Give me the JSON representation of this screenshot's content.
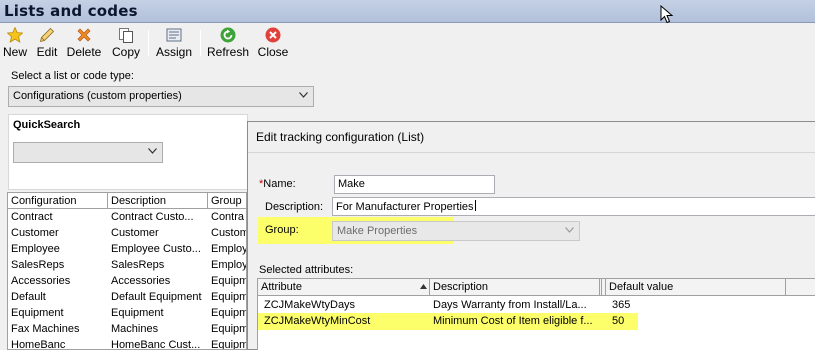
{
  "window": {
    "title": "Lists and codes"
  },
  "toolbar": {
    "new": "New",
    "edit": "Edit",
    "delete": "Delete",
    "copy": "Copy",
    "assign": "Assign",
    "refresh": "Refresh",
    "close": "Close"
  },
  "list_type": {
    "caption": "Select a list or code type:",
    "selected": "Configurations (custom properties)"
  },
  "quicksearch": {
    "title": "QuickSearch",
    "value": ""
  },
  "config_grid": {
    "columns": [
      "Configuration",
      "Description",
      "Group"
    ],
    "rows": [
      [
        "Contract",
        "Contract Custo...",
        "Contra"
      ],
      [
        "Customer",
        "Customer",
        "Custom"
      ],
      [
        "Employee",
        "Employee Custo...",
        "Employ"
      ],
      [
        "SalesReps",
        "SalesReps",
        "Employ"
      ],
      [
        "Accessories",
        "Accessories",
        "Equipm"
      ],
      [
        "Default",
        "Default Equipment",
        "Equipm"
      ],
      [
        "Equipment",
        "Equipment",
        "Equipm"
      ],
      [
        "Fax Machines",
        "Machines",
        "Equipm"
      ],
      [
        "HomeBanc",
        "HomeBanc Cust...",
        "Equipm"
      ]
    ]
  },
  "dialog": {
    "title": "Edit tracking configuration (List)",
    "name_label": "Name:",
    "name_required_marker": "*",
    "name_value": "Make",
    "description_label": "Description:",
    "description_value": "For Manufacturer Properties",
    "group_label": "Group:",
    "group_value": "Make Properties",
    "attributes_label": "Selected attributes:",
    "attributes": {
      "columns": [
        "Attribute",
        "Description",
        "Default value"
      ],
      "rows": [
        [
          "ZCJMakeWtyDays",
          "Days Warranty from Install/La...",
          "365"
        ],
        [
          "ZCJMakeWtyMinCost",
          "Minimum Cost of Item eligible f...",
          "50"
        ]
      ]
    }
  },
  "colors": {
    "highlight": "#fdff6a",
    "titlebar": "#b8c6dd",
    "required": "#d00000"
  }
}
